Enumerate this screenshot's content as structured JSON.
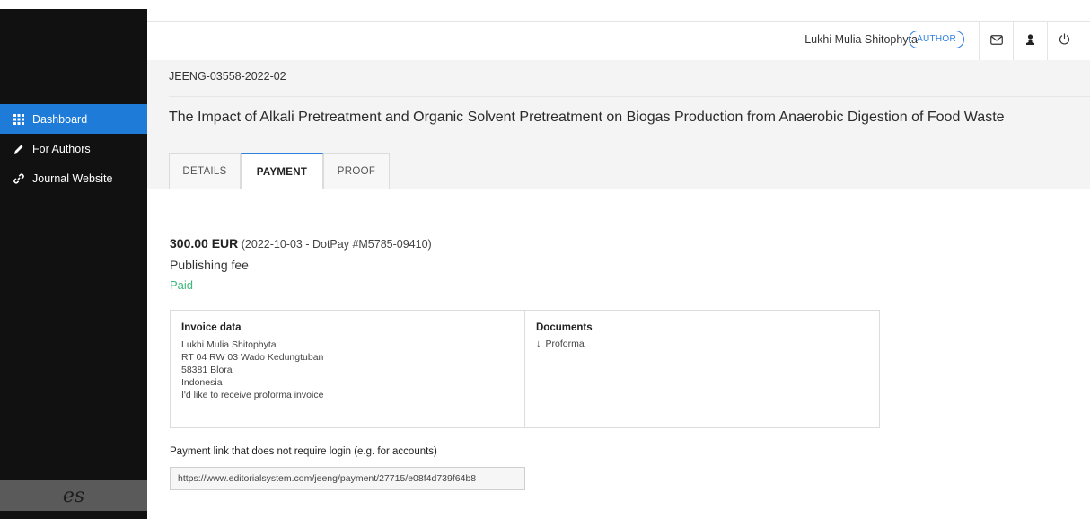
{
  "sidebar": {
    "items": [
      {
        "label": "Dashboard",
        "icon": "grid-icon",
        "active": true
      },
      {
        "label": "For Authors",
        "icon": "pencil-icon",
        "active": false
      },
      {
        "label": "Journal Website",
        "icon": "link-icon",
        "active": false
      }
    ],
    "brand_text": "es"
  },
  "header": {
    "user_name": "Lukhi Mulia Shitophyta",
    "role_badge": "AUTHOR",
    "icons": [
      "envelope-icon",
      "user-icon",
      "power-icon"
    ]
  },
  "manuscript": {
    "id": "JEENG-03558-2022-02",
    "title": "The Impact of Alkali Pretreatment and Organic Solvent Pretreatment on Biogas Production from Anaerobic Digestion of Food Waste"
  },
  "tabs": [
    {
      "label": "DETAILS",
      "active": false
    },
    {
      "label": "PAYMENT",
      "active": true
    },
    {
      "label": "PROOF",
      "active": false
    }
  ],
  "payment": {
    "amount": "300.00 EUR",
    "details": "(2022-10-03 - DotPay #M5785-09410)",
    "description": "Publishing fee",
    "status": "Paid",
    "status_color": "#3cb878"
  },
  "invoice": {
    "title": "Invoice data",
    "lines": [
      "Lukhi Mulia Shitophyta",
      "RT 04 RW 03 Wado Kedungtuban",
      "58381 Blora",
      "Indonesia",
      "I'd like to receive proforma invoice"
    ]
  },
  "documents": {
    "title": "Documents",
    "link_label": "Proforma"
  },
  "payment_link": {
    "label": "Payment link that does not require login (e.g. for accounts)",
    "value": "https://www.editorialsystem.com/jeeng/payment/27715/e08f4d739f64b8"
  },
  "colors": {
    "accent": "#1f7bd8",
    "sidebar_bg": "#111111",
    "paid_green": "#3cb878"
  }
}
